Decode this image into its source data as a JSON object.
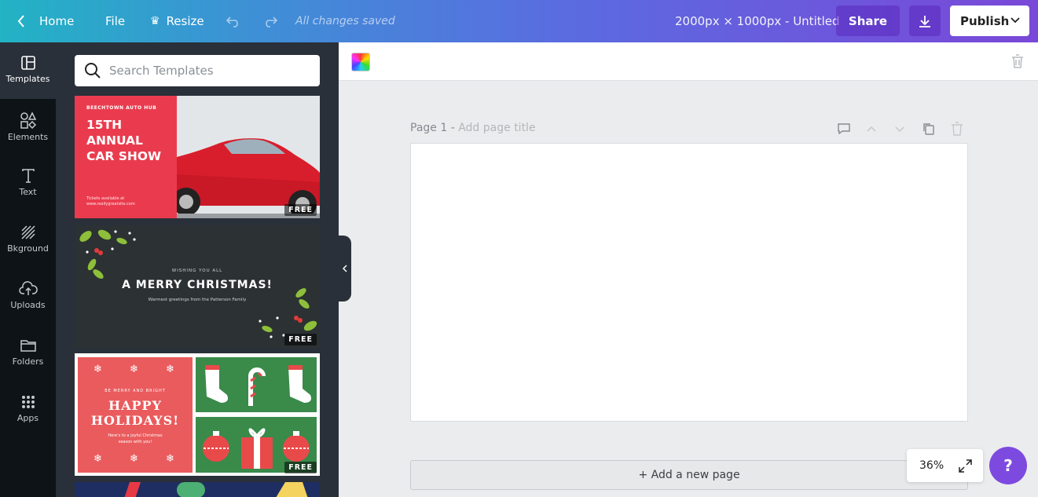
{
  "topbar": {
    "home": "Home",
    "file": "File",
    "resize": "Resize",
    "saved_status": "All changes saved",
    "document_name": "2000px × 1000px - Untitled",
    "share": "Share",
    "publish": "Publish"
  },
  "sidebar": {
    "items": [
      {
        "label": "Templates",
        "icon": "templates-icon"
      },
      {
        "label": "Elements",
        "icon": "elements-icon"
      },
      {
        "label": "Text",
        "icon": "text-icon"
      },
      {
        "label": "Bkground",
        "icon": "background-icon"
      },
      {
        "label": "Uploads",
        "icon": "uploads-icon"
      },
      {
        "label": "Folders",
        "icon": "folders-icon"
      },
      {
        "label": "Apps",
        "icon": "apps-icon"
      }
    ]
  },
  "templates_panel": {
    "search_placeholder": "Search Templates",
    "badge": "FREE",
    "car_show": {
      "hub": "BEECHTOWN AUTO HUB",
      "line1": "15TH",
      "line2": "ANNUAL",
      "line3": "CAR SHOW",
      "small1": "Tickets available at",
      "small2": "www.reallygreatsite.com"
    },
    "christmas": {
      "wishing": "WISHING YOU ALL",
      "headline": "A MERRY CHRISTMAS!",
      "greeting": "Warmest greetings from the Patterson Family"
    },
    "holidays": {
      "top": "BE MERRY AND BRIGHT",
      "line1": "HAPPY",
      "line2": "HOLIDAYS!",
      "sub1": "Here's to a joyful Christmas",
      "sub2": "season with you!"
    }
  },
  "editor": {
    "page_label": "Page 1 -",
    "page_title_placeholder": "Add page title",
    "add_page": "+ Add a new page",
    "zoom": "36%",
    "help": "?"
  },
  "colors": {
    "accent": "#7d4ae0",
    "nav_bg": "#0e1318",
    "panel_bg": "#293039"
  }
}
